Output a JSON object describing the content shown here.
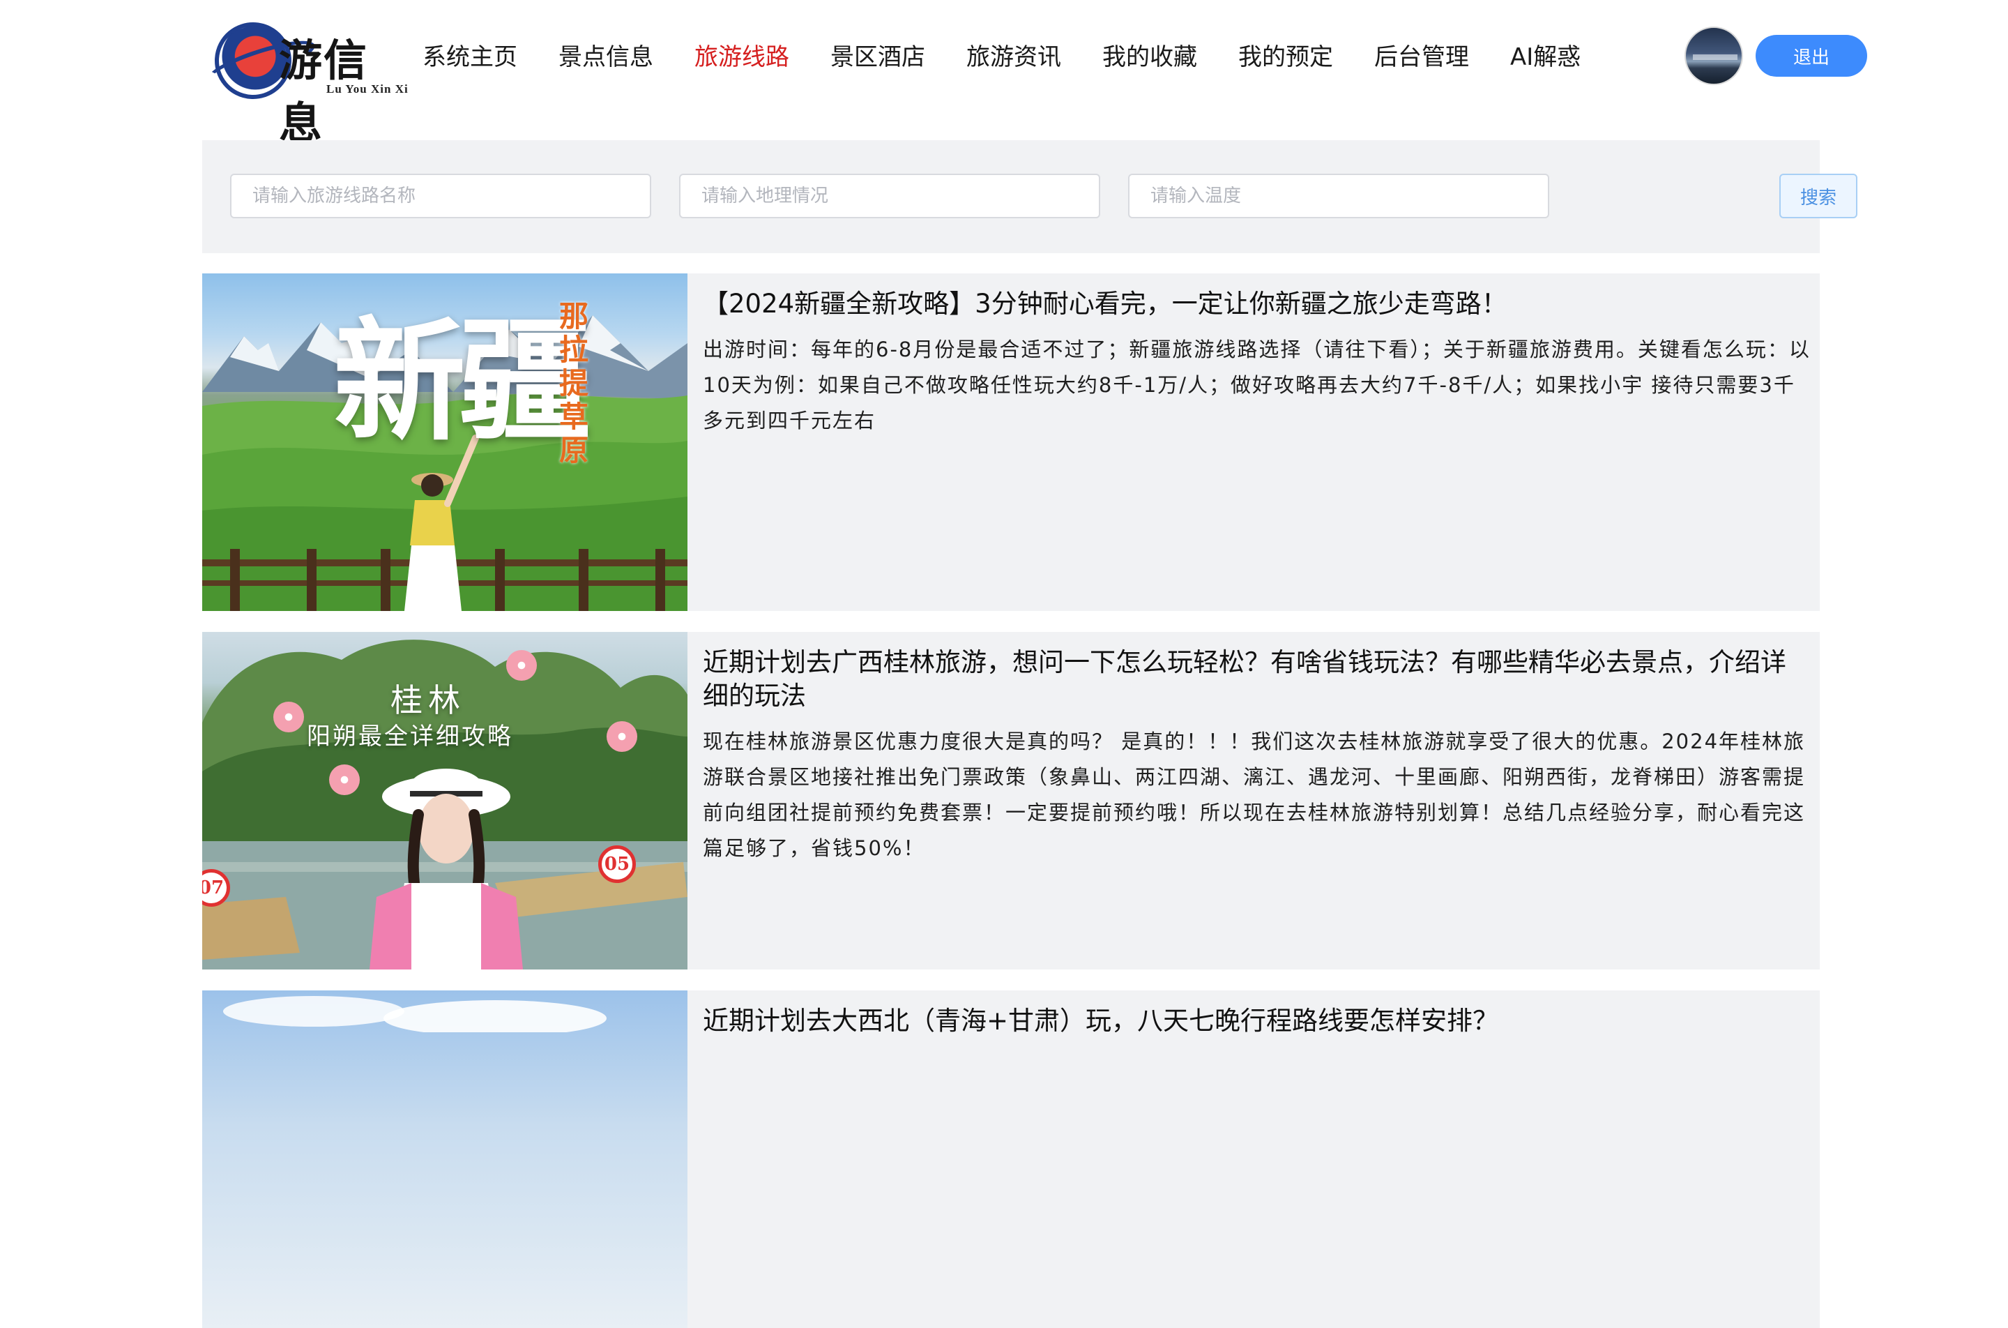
{
  "logo": {
    "cn": "游信息",
    "en": "Lu You Xin Xi"
  },
  "nav": {
    "items": [
      {
        "label": "系统主页",
        "active": false
      },
      {
        "label": "景点信息",
        "active": false
      },
      {
        "label": "旅游线路",
        "active": true
      },
      {
        "label": "景区酒店",
        "active": false
      },
      {
        "label": "旅游资讯",
        "active": false
      },
      {
        "label": "我的收藏",
        "active": false
      },
      {
        "label": "我的预定",
        "active": false
      },
      {
        "label": "后台管理",
        "active": false
      },
      {
        "label": "AI解惑",
        "active": false
      }
    ]
  },
  "user": {
    "logout_label": "退出"
  },
  "search": {
    "route_name_placeholder": "请输入旅游线路名称",
    "geo_placeholder": "请输入地理情况",
    "temp_placeholder": "请输入温度",
    "button_label": "搜索"
  },
  "routes": [
    {
      "title": "【2024新疆全新攻略】3分钟耐心看完，一定让你新疆之旅少走弯路！",
      "desc": "出游时间：每年的6-8月份是最合适不过了；新疆旅游线路选择（请往下看）；关于新疆旅游费用。关键看怎么玩：以10天为例：如果自己不做攻略任性玩大约8千-1万/人；做好攻略再去大约7千-8千/人；如果找小宇 接待只需要3千多元到四千元左右",
      "image_text": {
        "big": "新疆",
        "vertical": "那拉提草原"
      }
    },
    {
      "title": "近期计划去广西桂林旅游，想问一下怎么玩轻松？有啥省钱玩法？有哪些精华必去景点，介绍详细的玩法",
      "desc": "现在桂林旅游景区优惠力度很大是真的吗？ 是真的！！！我们这次去桂林旅游就享受了很大的优惠。2024年桂林旅游联合景区地接社推出免门票政策（象鼻山、两江四湖、漓江、遇龙河、十里画廊、阳朔西街，龙脊梯田）游客需提前向组团社提前预约免费套票！一定要提前预约哦！所以现在去桂林旅游特别划算！总结几点经验分享，耐心看完这篇足够了，省钱50%！",
      "image_text": {
        "title": "桂林",
        "subtitle": "阳朔最全详细攻略",
        "sign_a": "05",
        "sign_b": "07"
      }
    },
    {
      "title": "近期计划去大西北（青海+甘肃）玩，八天七晚行程路线要怎样安排？"
    }
  ]
}
